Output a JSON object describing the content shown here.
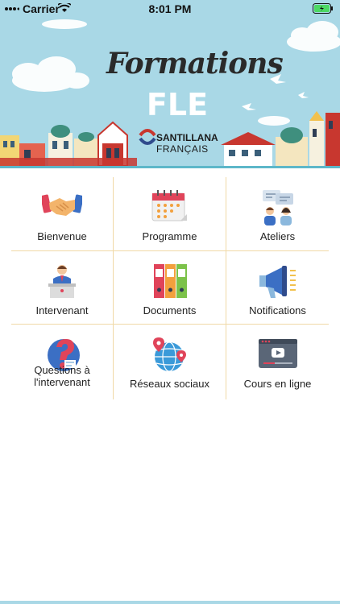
{
  "status_bar": {
    "carrier": "Carrier",
    "time": "8:01 PM"
  },
  "banner": {
    "title": "Formations",
    "subtitle": "FLE",
    "brand_name": "SANTILLANA",
    "brand_sub": "FRANÇAIS"
  },
  "menu": {
    "items": [
      {
        "label": "Bienvenue",
        "icon": "handshake-icon"
      },
      {
        "label": "Programme",
        "icon": "calendar-icon"
      },
      {
        "label": "Ateliers",
        "icon": "people-chat-icon"
      },
      {
        "label": "Intervenant",
        "icon": "speaker-podium-icon"
      },
      {
        "label": "Documents",
        "icon": "binders-icon"
      },
      {
        "label": "Notifications",
        "icon": "megaphone-icon"
      },
      {
        "label": "Questions à\nl'intervenant",
        "icon": "question-icon"
      },
      {
        "label": "Réseaux sociaux",
        "icon": "globe-network-icon"
      },
      {
        "label": "Cours en ligne",
        "icon": "video-player-icon"
      }
    ]
  },
  "colors": {
    "banner_bg": "#a9d8e6",
    "grid_lines": "#f0d9a6",
    "battery": "#4cd964"
  }
}
